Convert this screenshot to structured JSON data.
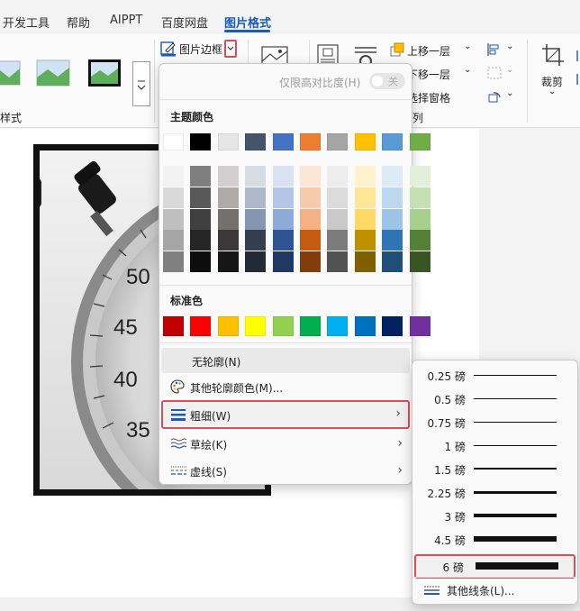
{
  "tabs": [
    {
      "label": "开发工具",
      "active": false
    },
    {
      "label": "帮助",
      "active": false
    },
    {
      "label": "AIPPT",
      "active": false
    },
    {
      "label": "百度网盘",
      "active": false
    },
    {
      "label": "图片格式",
      "active": true
    }
  ],
  "ribbon": {
    "border_button": "图片边框",
    "styles_group_label": "样式",
    "bring_forward": "上移一层",
    "send_backward": "下移一层",
    "selection_pane": "选择窗格",
    "arrange_group_label": "列",
    "crop": "裁剪"
  },
  "color_menu": {
    "high_contrast_only": "仅限高对比度(H)",
    "toggle_state": "关",
    "theme_colors_label": "主题颜色",
    "theme_colors": [
      "#FFFFFF",
      "#000000",
      "#E7E6E6",
      "#44546A",
      "#4472C4",
      "#ED7D31",
      "#A5A5A5",
      "#FFC000",
      "#5B9BD5",
      "#70AD47"
    ],
    "theme_shades": [
      [
        "#F2F2F2",
        "#D9D9D9",
        "#BFBFBF",
        "#A6A6A6",
        "#808080"
      ],
      [
        "#7F7F7F",
        "#595959",
        "#404040",
        "#262626",
        "#0D0D0D"
      ],
      [
        "#D0CECE",
        "#AEAAAA",
        "#757070",
        "#3A3838",
        "#171616"
      ],
      [
        "#D6DCE4",
        "#ADB9CA",
        "#8496B0",
        "#333F4F",
        "#222A35"
      ],
      [
        "#D9E2F3",
        "#B4C6E7",
        "#8EAADB",
        "#2F5496",
        "#1F3864"
      ],
      [
        "#FBE5D5",
        "#F7CAAC",
        "#F4B183",
        "#C55A11",
        "#833C0B"
      ],
      [
        "#EDEDED",
        "#DBDBDB",
        "#C9C9C9",
        "#7B7B7B",
        "#525252"
      ],
      [
        "#FFF2CC",
        "#FFE598",
        "#FFD965",
        "#BF9000",
        "#7F6000"
      ],
      [
        "#DEEBF6",
        "#BDD7EE",
        "#9DC3E6",
        "#2E75B5",
        "#1F4E79"
      ],
      [
        "#E2EFD9",
        "#C5E0B3",
        "#A8D08D",
        "#538135",
        "#375623"
      ]
    ],
    "standard_colors_label": "标准色",
    "standard_colors": [
      "#C00000",
      "#FF0000",
      "#FFC000",
      "#FFFF00",
      "#92D050",
      "#00B050",
      "#00B0F0",
      "#0070C0",
      "#002060",
      "#7030A0"
    ],
    "no_outline": "无轮廓(N)",
    "more_colors": "其他轮廓颜色(M)...",
    "weight": "粗细(W)",
    "sketched": "草绘(K)",
    "dashes": "虚线(S)"
  },
  "weight_menu": {
    "items": [
      {
        "label": "0.25 磅",
        "weight_pt": 0.25
      },
      {
        "label": "0.5 磅",
        "weight_pt": 0.5
      },
      {
        "label": "0.75 磅",
        "weight_pt": 0.75
      },
      {
        "label": "1 磅",
        "weight_pt": 1
      },
      {
        "label": "1.5 磅",
        "weight_pt": 1.5
      },
      {
        "label": "2.25 磅",
        "weight_pt": 2.25
      },
      {
        "label": "3 磅",
        "weight_pt": 3
      },
      {
        "label": "4.5 磅",
        "weight_pt": 4.5
      },
      {
        "label": "6 磅",
        "weight_pt": 6,
        "highlighted": true
      }
    ],
    "more_lines": "其他线条(L)..."
  },
  "colors": {
    "accent_blue": "#185ABD",
    "highlight_red": "#E04B5A",
    "menu_hover": "#E8E8E8"
  }
}
